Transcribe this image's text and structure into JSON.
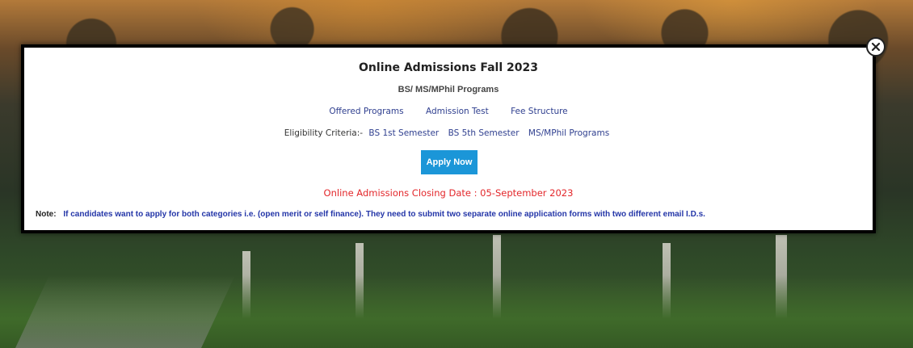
{
  "modal": {
    "title": "Online Admissions Fall 2023",
    "subtitle": "BS/ MS/MPhil Programs",
    "links": [
      "Offered Programs",
      "Admission Test",
      "Fee Structure"
    ],
    "eligibility_label": "Eligibility Criteria:-",
    "eligibility_links": [
      "BS 1st Semester",
      "BS 5th Semester",
      "MS/MPhil Programs"
    ],
    "apply_label": "Apply Now",
    "closing_text": "Online Admissions Closing Date : 05-September 2023",
    "note_label": "Note:",
    "note_text": "If candidates want to apply for both categories i.e. (open merit or self finance). They need to submit two separate online application forms with two different email I.D.s."
  },
  "icons": {
    "close": "close-circle-icon"
  },
  "colors": {
    "apply_button": "#1b96d8",
    "link": "#2f3f8f",
    "closing_date": "#e3272b",
    "note_text": "#2436a8"
  }
}
